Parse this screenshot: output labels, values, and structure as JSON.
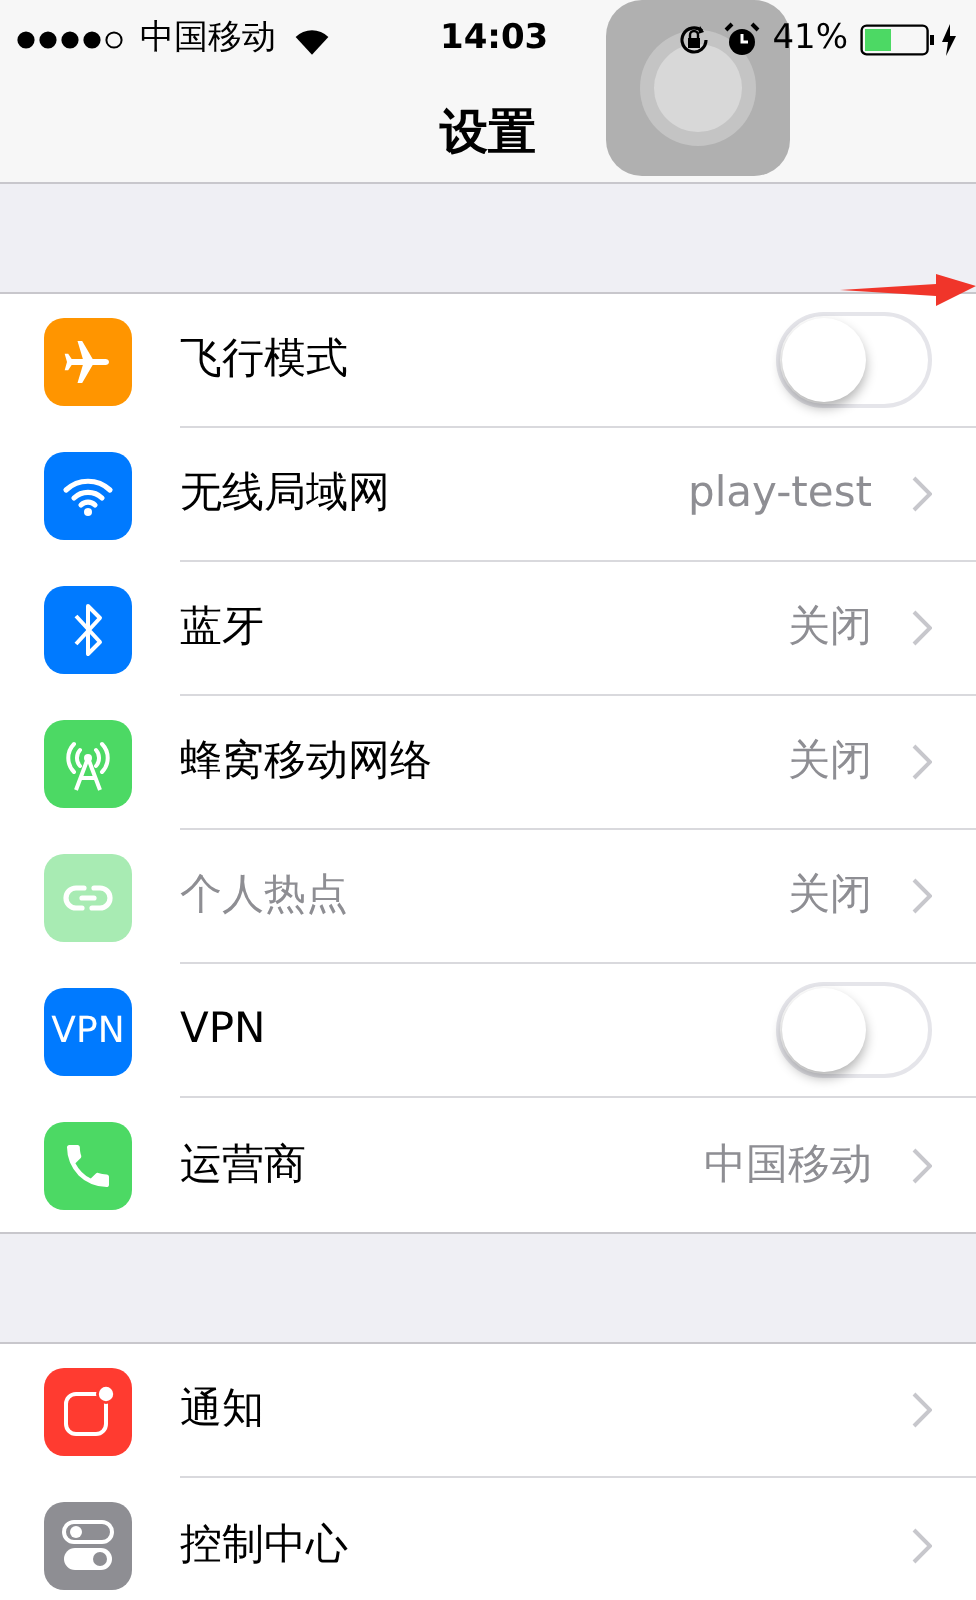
{
  "status_bar": {
    "carrier": "中国移动",
    "time": "14:03",
    "battery": "41%"
  },
  "nav": {
    "title": "设置"
  },
  "groups": [
    {
      "rows": [
        {
          "kind": "toggle",
          "label": "飞行模式",
          "on": false,
          "disabled": false
        },
        {
          "kind": "link",
          "label": "无线局域网",
          "value": "play-test",
          "disabled": false
        },
        {
          "kind": "link",
          "label": "蓝牙",
          "value": "关闭",
          "disabled": false
        },
        {
          "kind": "link",
          "label": "蜂窝移动网络",
          "value": "关闭",
          "disabled": false
        },
        {
          "kind": "link",
          "label": "个人热点",
          "value": "关闭",
          "disabled": true
        },
        {
          "kind": "toggle",
          "icon_text": "VPN",
          "label": "VPN",
          "on": false,
          "disabled": false
        },
        {
          "kind": "link",
          "label": "运营商",
          "value": "中国移动",
          "disabled": false
        }
      ]
    },
    {
      "rows": [
        {
          "kind": "link",
          "label": "通知",
          "disabled": false
        },
        {
          "kind": "link",
          "label": "控制中心",
          "disabled": false
        }
      ]
    }
  ]
}
